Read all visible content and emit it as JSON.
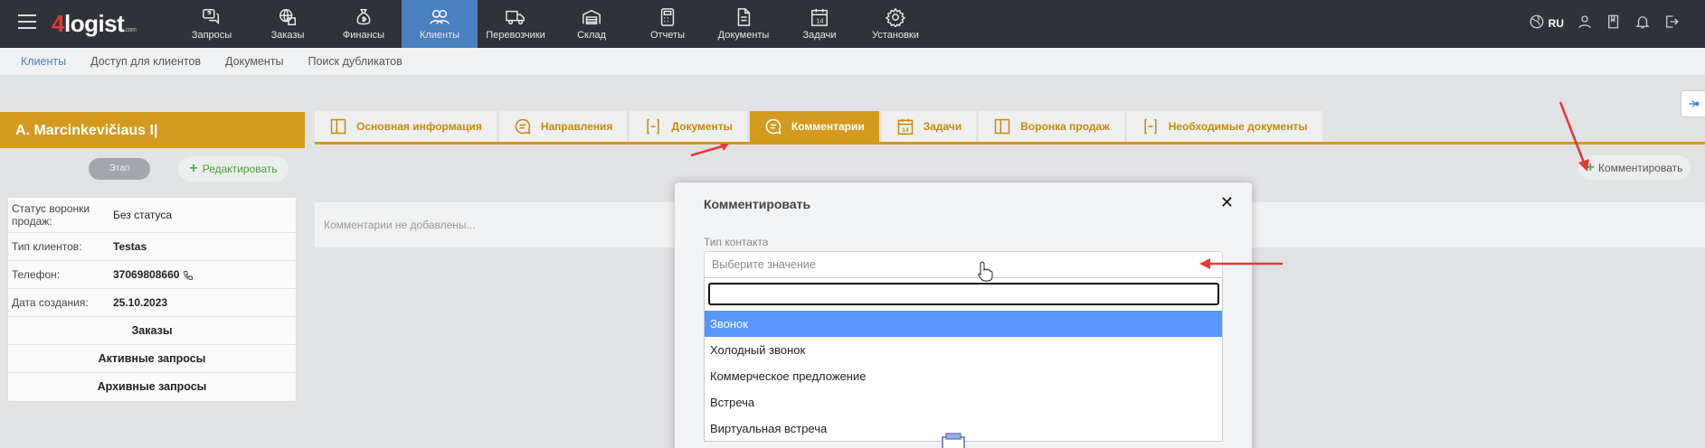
{
  "brand": {
    "logo_number": "4",
    "logo_text": "logist",
    "logo_suffix": ".com"
  },
  "nav": {
    "items": [
      {
        "label": "Запросы",
        "icon": "chat-question-icon"
      },
      {
        "label": "Заказы",
        "icon": "globe-box-icon"
      },
      {
        "label": "Финансы",
        "icon": "money-bag-icon"
      },
      {
        "label": "Клиенты",
        "icon": "users-icon",
        "active": true
      },
      {
        "label": "Перевозчики",
        "icon": "truck-icon"
      },
      {
        "label": "Склад",
        "icon": "warehouse-icon"
      },
      {
        "label": "Отчеты",
        "icon": "calculator-icon"
      },
      {
        "label": "Документы",
        "icon": "document-icon"
      },
      {
        "label": "Задачи",
        "icon": "calendar-icon"
      },
      {
        "label": "Установки",
        "icon": "gear-icon"
      }
    ]
  },
  "topright": {
    "language": "RU"
  },
  "subnav": {
    "items": [
      "Клиенты",
      "Доступ для клиентов",
      "Документы",
      "Поиск дубликатов"
    ]
  },
  "client": {
    "name": "A. Marcinkevičiaus I|",
    "stage_button": "Этап",
    "edit_button": "Редактировать",
    "info": [
      {
        "key": "Статус воронки продаж:",
        "value": "Без статуса"
      },
      {
        "key": "Тип клиентов:",
        "value": "Testas"
      },
      {
        "key": "Телефон:",
        "value": "37069808660"
      },
      {
        "key": "Дата создания:",
        "value": "25.10.2023"
      }
    ],
    "links": [
      "Заказы",
      "Активные запросы",
      "Архивные запросы"
    ]
  },
  "tabs": [
    {
      "label": "Основная информация",
      "icon": "panel-icon"
    },
    {
      "label": "Направления",
      "icon": "chat-icon"
    },
    {
      "label": "Документы",
      "icon": "document-bracket-icon"
    },
    {
      "label": "Комментарии",
      "icon": "chat-icon",
      "active": true
    },
    {
      "label": "Задачи",
      "icon": "calendar-icon"
    },
    {
      "label": "Воронка продаж",
      "icon": "panel-icon"
    },
    {
      "label": "Необходимые документы",
      "icon": "document-bracket-icon"
    }
  ],
  "comments": {
    "add_button": "Комментировать",
    "empty_text": "Комментарии не добавлены..."
  },
  "modal": {
    "title": "Комментировать",
    "close": "✕",
    "field_label": "Тип контакта",
    "select_placeholder": "Выберите значение",
    "search_value": "",
    "options": [
      "Звонок",
      "Холодный звонок",
      "Коммерческое предложение",
      "Встреча",
      "Виртуальная встреча"
    ],
    "highlighted_index": 0
  },
  "colors": {
    "topbar": "#2f3237",
    "nav_active": "#4a7fc1",
    "accent": "#d49a1e",
    "highlight": "#5897fb",
    "arrow": "#e53935",
    "success": "#4caf50"
  }
}
